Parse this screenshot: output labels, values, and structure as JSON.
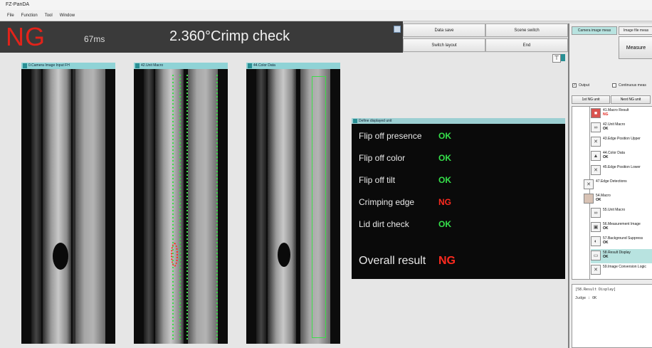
{
  "window": {
    "title": "FZ-PanDA"
  },
  "menu": [
    "File",
    "Function",
    "Tool",
    "Window"
  ],
  "status": {
    "result": "NG",
    "time": "67ms",
    "headline": "2.360°Crimp check"
  },
  "buttons": {
    "data_save": "Data save",
    "scene_switch": "Scene switch",
    "switch_layout": "Switch layout",
    "end": "End"
  },
  "panels": [
    {
      "title": "0.Camera Image Input FH"
    },
    {
      "title": "42.Unit Macro"
    },
    {
      "title": "44.Color Data"
    }
  ],
  "result_panel": {
    "title": "Define displayed unit",
    "rows": [
      {
        "label": "Flip off presence",
        "value": "OK"
      },
      {
        "label": "Flip off color",
        "value": "OK"
      },
      {
        "label": "Flip off tilt",
        "value": "OK"
      },
      {
        "label": "Crimping edge",
        "value": "NG"
      },
      {
        "label": "Lid dirt check",
        "value": "OK"
      }
    ],
    "overall_label": "Overall result",
    "overall_value": "NG"
  },
  "sidebar": {
    "tabs": [
      "Camera image meas",
      "Image file meas"
    ],
    "measure": "Measure",
    "output_label": "Output",
    "continuous_label": "Continuous meas",
    "first_ng": "1st NG unit",
    "next_ng": "Next NG unit",
    "flow": [
      {
        "name": "41.Macro Result",
        "result": "NG"
      },
      {
        "name": "42.Unit Macro",
        "result": "OK"
      },
      {
        "name": "43.Edge Position Upper",
        "result": ""
      },
      {
        "name": "44.Color Data",
        "result": "OK"
      },
      {
        "name": "45.Edge Position Lower",
        "result": ""
      },
      {
        "name": "47.Edge Detections",
        "result": ""
      },
      {
        "name": "54.Macro",
        "result": "OK"
      },
      {
        "name": "55.Unit Macro",
        "result": ""
      },
      {
        "name": "56.Measurement Image",
        "result": "OK"
      },
      {
        "name": "57.Background Suppress",
        "result": "OK"
      },
      {
        "name": "58.Result Display",
        "result": "OK"
      },
      {
        "name": "59.Image Conversion Logic",
        "result": ""
      }
    ],
    "console_lines": [
      "[58.Result Display]",
      "Judge : OK"
    ]
  },
  "colors": {
    "ng_red": "#e2231a",
    "ok_green": "#35e04a",
    "accent_teal": "#8fd3d6"
  }
}
